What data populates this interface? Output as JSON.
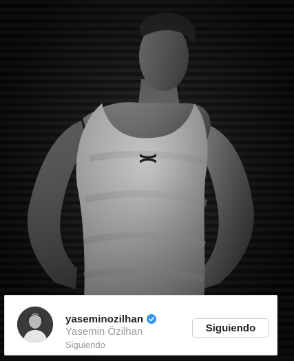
{
  "post": {
    "image_description_icon": "person-photo"
  },
  "profile": {
    "username": "yaseminozilhan",
    "verified_icon": "verified-badge-icon",
    "full_name": "Yasemin Özilhan",
    "status": "Siguiendo",
    "follow_button_label": "Siguiendo",
    "accent_color": "#3897f0"
  }
}
